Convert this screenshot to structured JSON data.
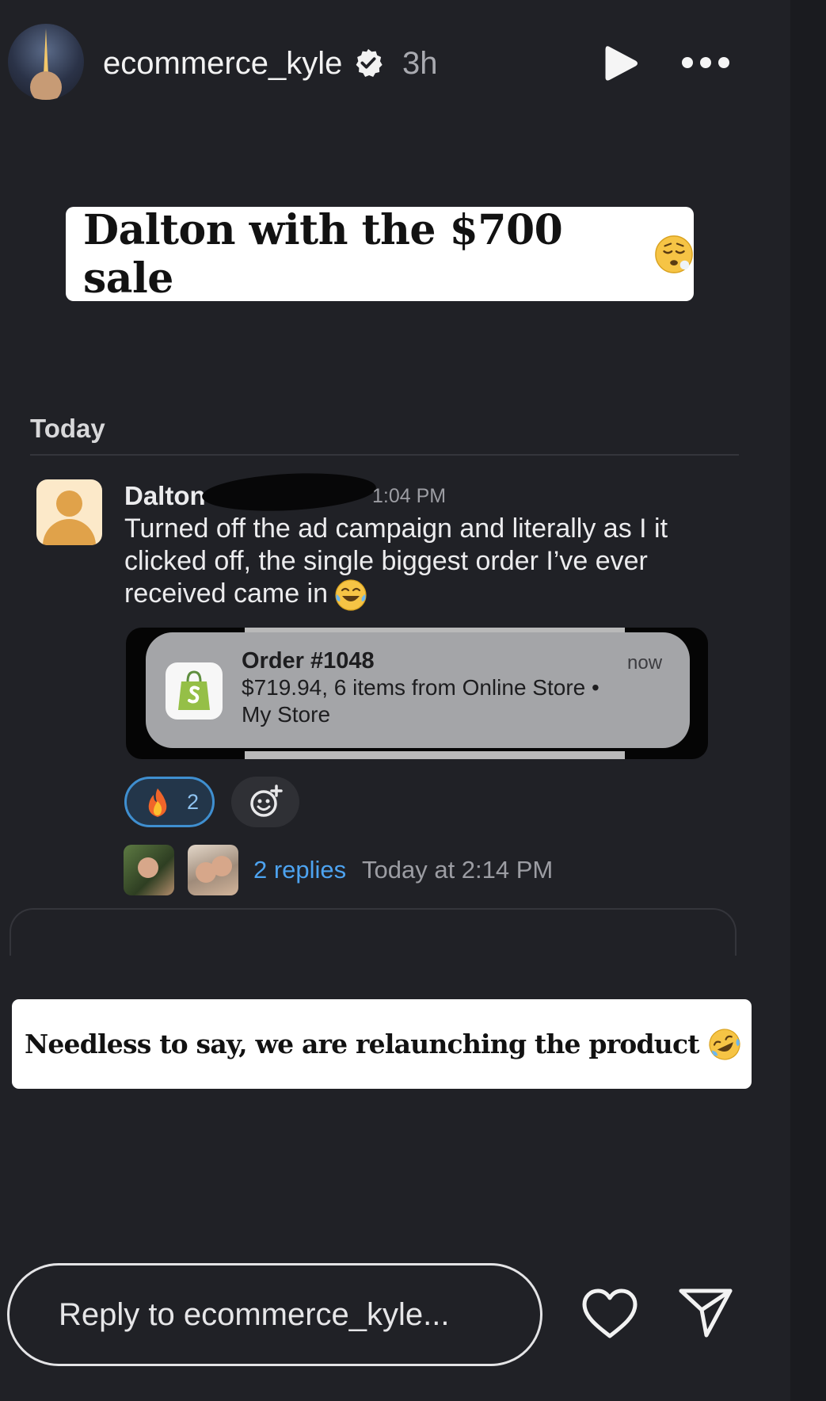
{
  "header": {
    "username": "ecommerce_kyle",
    "time_ago": "3h",
    "icons": [
      "verified-badge-icon",
      "play-icon",
      "more-options-icon"
    ]
  },
  "sticker_top": {
    "text": "Dalton with the $700 sale",
    "emoji": "disappointed-relieved-face"
  },
  "chat": {
    "day_label": "Today",
    "sender": "Dalton",
    "timestamp": "1:04 PM",
    "message_line1": "Turned off the ad campaign and literally as I it",
    "message_line2": "clicked off, the single biggest order I’ve ever",
    "message_line3": "received came in",
    "notification": {
      "title": "Order #1048",
      "line1": "$719.94, 6 items from Online Store •",
      "line2": "My Store",
      "time": "now"
    },
    "reaction": {
      "emoji": "fire",
      "count": "2"
    },
    "thread": {
      "replies": "2 replies",
      "last_reply": "Today at 2:14 PM"
    }
  },
  "sticker_bottom": {
    "text": "Needless to say, we are relaunching the product",
    "emoji": "rolling-on-floor-laughing"
  },
  "footer": {
    "reply_placeholder": "Reply to ecommerce_kyle..."
  },
  "colors": {
    "background": "#202126",
    "link": "#4da3f0",
    "reaction_border": "#3f8fd0",
    "shopify_green": "#95bf47"
  }
}
